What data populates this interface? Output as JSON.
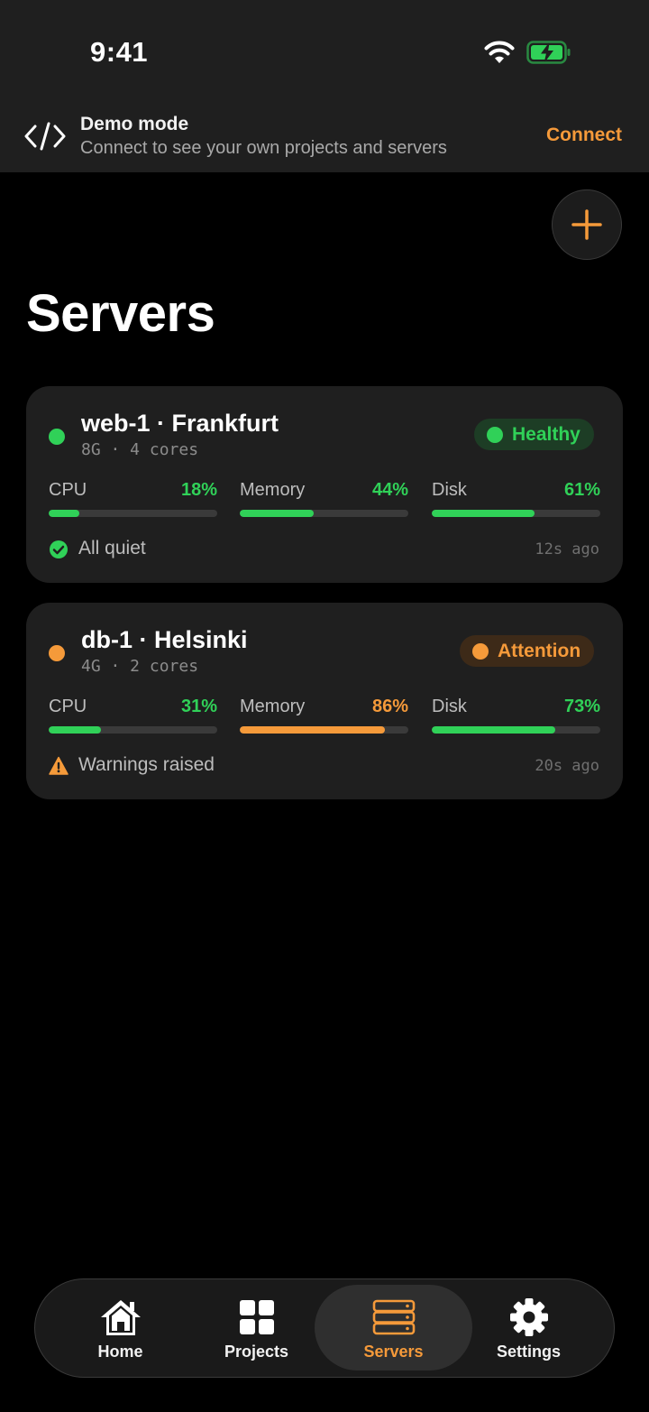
{
  "status_bar": {
    "time": "9:41"
  },
  "banner": {
    "title": "Demo mode",
    "subtitle": "Connect to see your own projects and servers",
    "action_label": "Connect"
  },
  "page": {
    "title": "Servers"
  },
  "colors": {
    "accent": "#f59a3a",
    "healthy": "#30d158",
    "attention": "#f59a3a",
    "card": "#1f1f1f"
  },
  "servers": [
    {
      "name": "web-1 · Frankfurt",
      "spec": "8G · 4 cores",
      "status": "Healthy",
      "status_color": "#30d158",
      "metrics": [
        {
          "label": "CPU",
          "value": "18%",
          "percent": 18,
          "color": "#30d158"
        },
        {
          "label": "Memory",
          "value": "44%",
          "percent": 44,
          "color": "#30d158"
        },
        {
          "label": "Disk",
          "value": "61%",
          "percent": 61,
          "color": "#30d158"
        }
      ],
      "footer_icon": "check-circle-icon",
      "footer": "All quiet",
      "updated": "12s ago"
    },
    {
      "name": "db-1 · Helsinki",
      "spec": "4G · 2 cores",
      "status": "Attention",
      "status_color": "#f59a3a",
      "metrics": [
        {
          "label": "CPU",
          "value": "31%",
          "percent": 31,
          "color": "#30d158"
        },
        {
          "label": "Memory",
          "value": "86%",
          "percent": 86,
          "color": "#f59a3a"
        },
        {
          "label": "Disk",
          "value": "73%",
          "percent": 73,
          "color": "#30d158"
        }
      ],
      "footer_icon": "warning-triangle-icon",
      "footer": "Warnings raised",
      "updated": "20s ago"
    }
  ],
  "tabs": [
    {
      "label": "Home",
      "icon": "home-icon",
      "active": false
    },
    {
      "label": "Projects",
      "icon": "grid-icon",
      "active": false
    },
    {
      "label": "Servers",
      "icon": "server-icon",
      "active": true
    },
    {
      "label": "Settings",
      "icon": "gear-icon",
      "active": false
    }
  ]
}
